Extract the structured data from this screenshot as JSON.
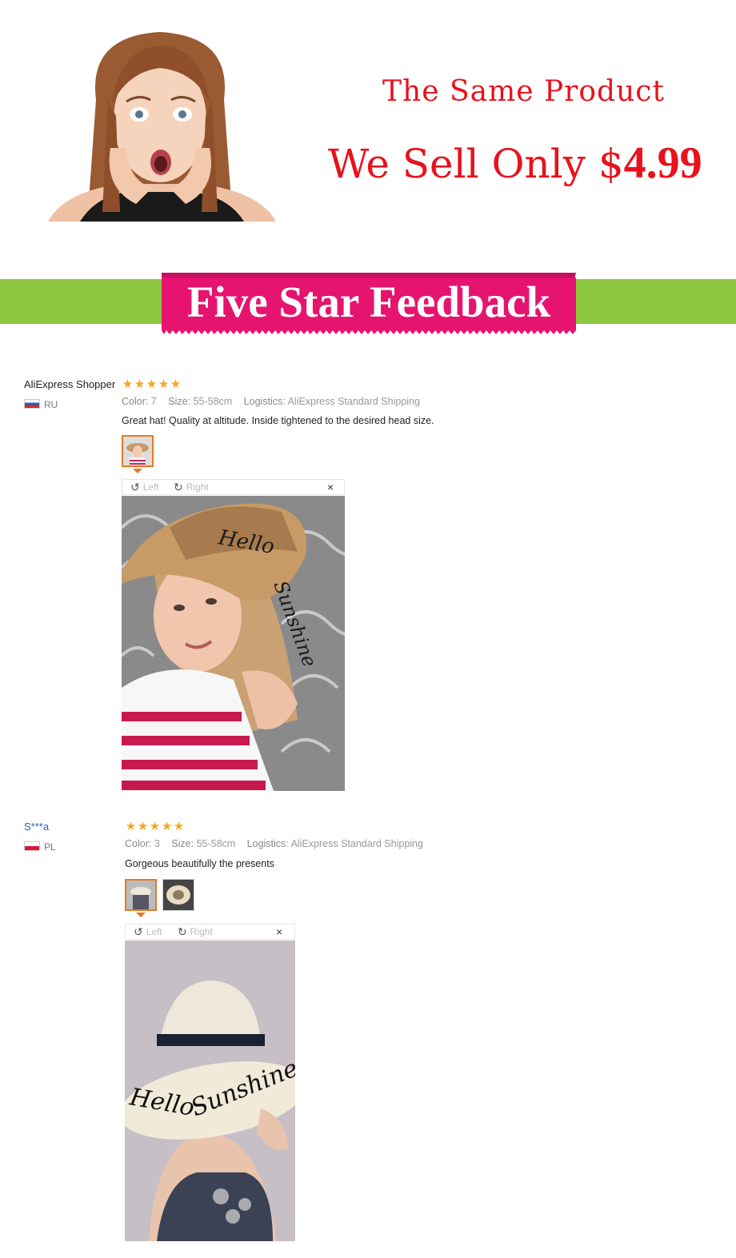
{
  "promo": {
    "line1": "The Same Product",
    "line2_prefix": "We Sell Only $",
    "price": "4.99"
  },
  "banner": {
    "title": "Five Star Feedback"
  },
  "colors": {
    "promo_red": "#e8121c",
    "banner_green": "#8dc63f",
    "banner_pink": "#e6136f",
    "star_orange": "#f5a623",
    "thumb_border_active": "#e67a20",
    "author_link": "#1a66b8"
  },
  "reviews": [
    {
      "author": "AliExpress Shopper",
      "country_code": "RU",
      "rating": 5,
      "color_label": "Color:",
      "color_value": "7",
      "size_label": "Size:",
      "size_value": "55-58cm",
      "logistics_label": "Logistics:",
      "logistics_value": "AliExpress Standard Shipping",
      "text": "Great hat! Quality at altitude. Inside tightened to the desired head size.",
      "viewer": {
        "left_label": "Left",
        "right_label": "Right",
        "close_icon": "×"
      }
    },
    {
      "author": "S***a",
      "country_code": "PL",
      "rating": 5,
      "color_label": "Color:",
      "color_value": "3",
      "size_label": "Size:",
      "size_value": "55-58cm",
      "logistics_label": "Logistics:",
      "logistics_value": "AliExpress Standard Shipping",
      "text": "Gorgeous beautifully the presents",
      "viewer": {
        "left_label": "Left",
        "right_label": "Right",
        "close_icon": "×"
      }
    }
  ],
  "icons": {
    "star": "★",
    "rotate_left": "↺",
    "rotate_right": "↻"
  }
}
